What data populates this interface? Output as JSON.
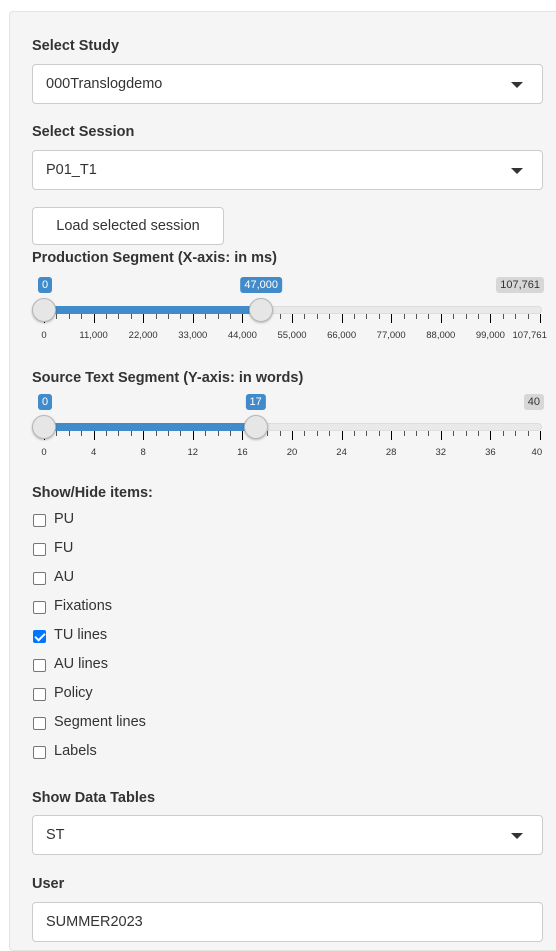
{
  "select_study": {
    "label": "Select Study",
    "value": "000Translogdemo"
  },
  "select_session": {
    "label": "Select Session",
    "value": "P01_T1"
  },
  "load_button": "Load selected session",
  "production_slider": {
    "label": "Production Segment (X-axis: in ms)",
    "min": 0,
    "max": 107761,
    "from": 0,
    "to": 47000,
    "from_label": "0",
    "to_label": "47,000",
    "max_label": "107,761",
    "tick_labels": [
      "0",
      "11,000",
      "22,000",
      "33,000",
      "44,000",
      "55,000",
      "66,000",
      "77,000",
      "88,000",
      "99,000",
      "107,761"
    ]
  },
  "source_slider": {
    "label": "Source Text Segment (Y-axis: in words)",
    "min": 0,
    "max": 40,
    "from": 0,
    "to": 17,
    "from_label": "0",
    "to_label": "17",
    "max_label": "40",
    "tick_labels": [
      "0",
      "4",
      "8",
      "12",
      "16",
      "20",
      "24",
      "28",
      "32",
      "36",
      "40"
    ]
  },
  "show_hide": {
    "label": "Show/Hide items:",
    "items": [
      {
        "label": "PU",
        "checked": false
      },
      {
        "label": "FU",
        "checked": false
      },
      {
        "label": "AU",
        "checked": false
      },
      {
        "label": "Fixations",
        "checked": false
      },
      {
        "label": "TU lines",
        "checked": true
      },
      {
        "label": "AU lines",
        "checked": false
      },
      {
        "label": "Policy",
        "checked": false
      },
      {
        "label": "Segment lines",
        "checked": false
      },
      {
        "label": "Labels",
        "checked": false
      }
    ]
  },
  "data_tables": {
    "label": "Show Data Tables",
    "value": "ST"
  },
  "user": {
    "label": "User",
    "value": "SUMMER2023"
  },
  "colors": {
    "accent": "#428bca",
    "checkbox": "#0075ff",
    "panel": "#f5f5f5"
  }
}
